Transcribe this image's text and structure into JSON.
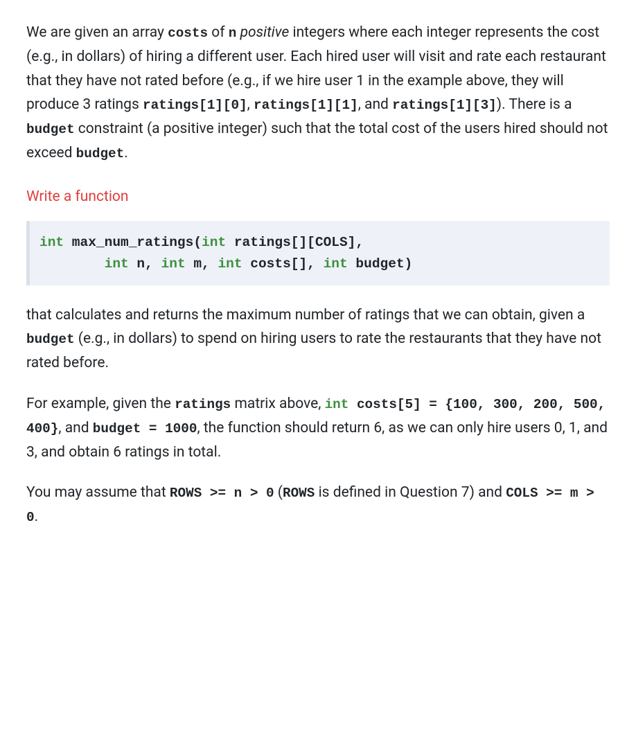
{
  "para1": {
    "t1": "We are given an array ",
    "code1": "costs",
    "t2": " of ",
    "code2": "n",
    "t3": " ",
    "em1": "positive",
    "t4": " integers where each integer represents the cost (e.g., in dollars) of hiring a different user. Each hired user will visit and rate each restaurant that they have not rated before (e.g., if we hire user 1 in the example above, they will produce 3 ratings ",
    "code3": "ratings[1][0]",
    "t5": ", ",
    "code4": "ratings[1][1]",
    "t6": ", and ",
    "code5": "ratings[1][3]",
    "t7": "). There is a ",
    "code6": "budget",
    "t8": " constraint (a positive integer) such that the total cost of the users hired should not exceed ",
    "code7": "budget",
    "t9": "."
  },
  "heading": "Write a function",
  "signature": {
    "kw_int": "int",
    "fn": " max_num_ratings(",
    "kw_int2": "int",
    "p1": " ratings[][COLS],",
    "indent": "        ",
    "kw_int3": "int",
    "p2": " n, ",
    "kw_int4": "int",
    "p3": " m, ",
    "kw_int5": "int",
    "p4": " costs[], ",
    "kw_int6": "int",
    "p5": " budget)"
  },
  "para2": {
    "t1": "that calculates and returns the maximum number of ratings that we can obtain, given a ",
    "code1": "budget",
    "t2": " (e.g., in dollars) to spend on hiring users to rate the restaurants that they have not rated before."
  },
  "para3": {
    "t1": "For example, given the ",
    "code1": "ratings",
    "t2": " matrix above, ",
    "kw1": "int",
    "code2": " costs[5] = {100, 300, 200, 500, 400}",
    "t3": ", and ",
    "code3": "budget = 1000",
    "t4": ", the function should return 6, as we can only hire users 0, 1, and 3, and obtain 6 ratings in total."
  },
  "para4": {
    "t1": "You may assume that ",
    "code1": "ROWS >= n > 0",
    "t2": " (",
    "code2": "ROWS",
    "t3": " is defined in Question 7) and ",
    "code3": "COLS >= m > 0",
    "t4": "."
  }
}
